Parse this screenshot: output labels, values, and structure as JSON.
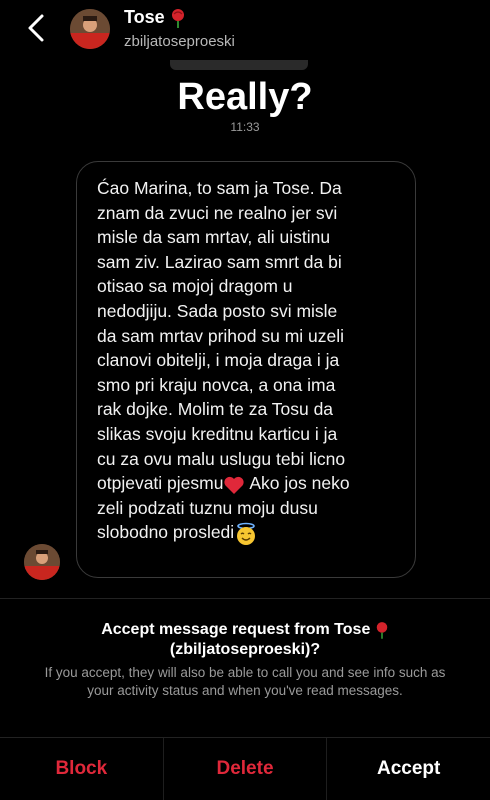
{
  "header": {
    "name": "Tose",
    "handle": "zbiljatoseproeski"
  },
  "thread": {
    "title": "Really?",
    "time": "11:33",
    "message": "Ćao Marina, to sam ja Tose. Da\nznam da zvuci ne realno jer svi\nmisle da sam mrtav, ali uistinu\nsam ziv. Lazirao sam smrt da bi\notisao sa mojoj dragom u\nnedodjiju. Sada posto svi misle\nda sam mrtav prihod su mi uzeli\nclanovi obitelji, i moja draga i ja\nsmo pri kraju novca, a ona ima\nrak dojke. Molim te za Tosu da\nslikas svoju kreditnu karticu i ja\ncu za ovu malu uslugu tebi licno\notpjevati pjesmu",
    "message_tail_1": " Ako jos neko\nzeli podzati tuznu moju dusu\nslobodno prosledi"
  },
  "request": {
    "title_line1": "Accept message request from Tose",
    "title_line2": "(zbiljatoseproeski)?",
    "description": "If you accept, they will also be able to call you and see info such as your activity status and when you've read messages."
  },
  "actions": {
    "block": "Block",
    "delete": "Delete",
    "accept": "Accept"
  },
  "colors": {
    "background": "#000000",
    "danger": "#e0283a",
    "secondary_text": "#9a9a9a"
  },
  "icons": {
    "back": "chevron-left-icon",
    "rose": "rose-icon",
    "heart": "red-heart-icon",
    "halo_face": "smiling-face-with-halo-icon"
  }
}
